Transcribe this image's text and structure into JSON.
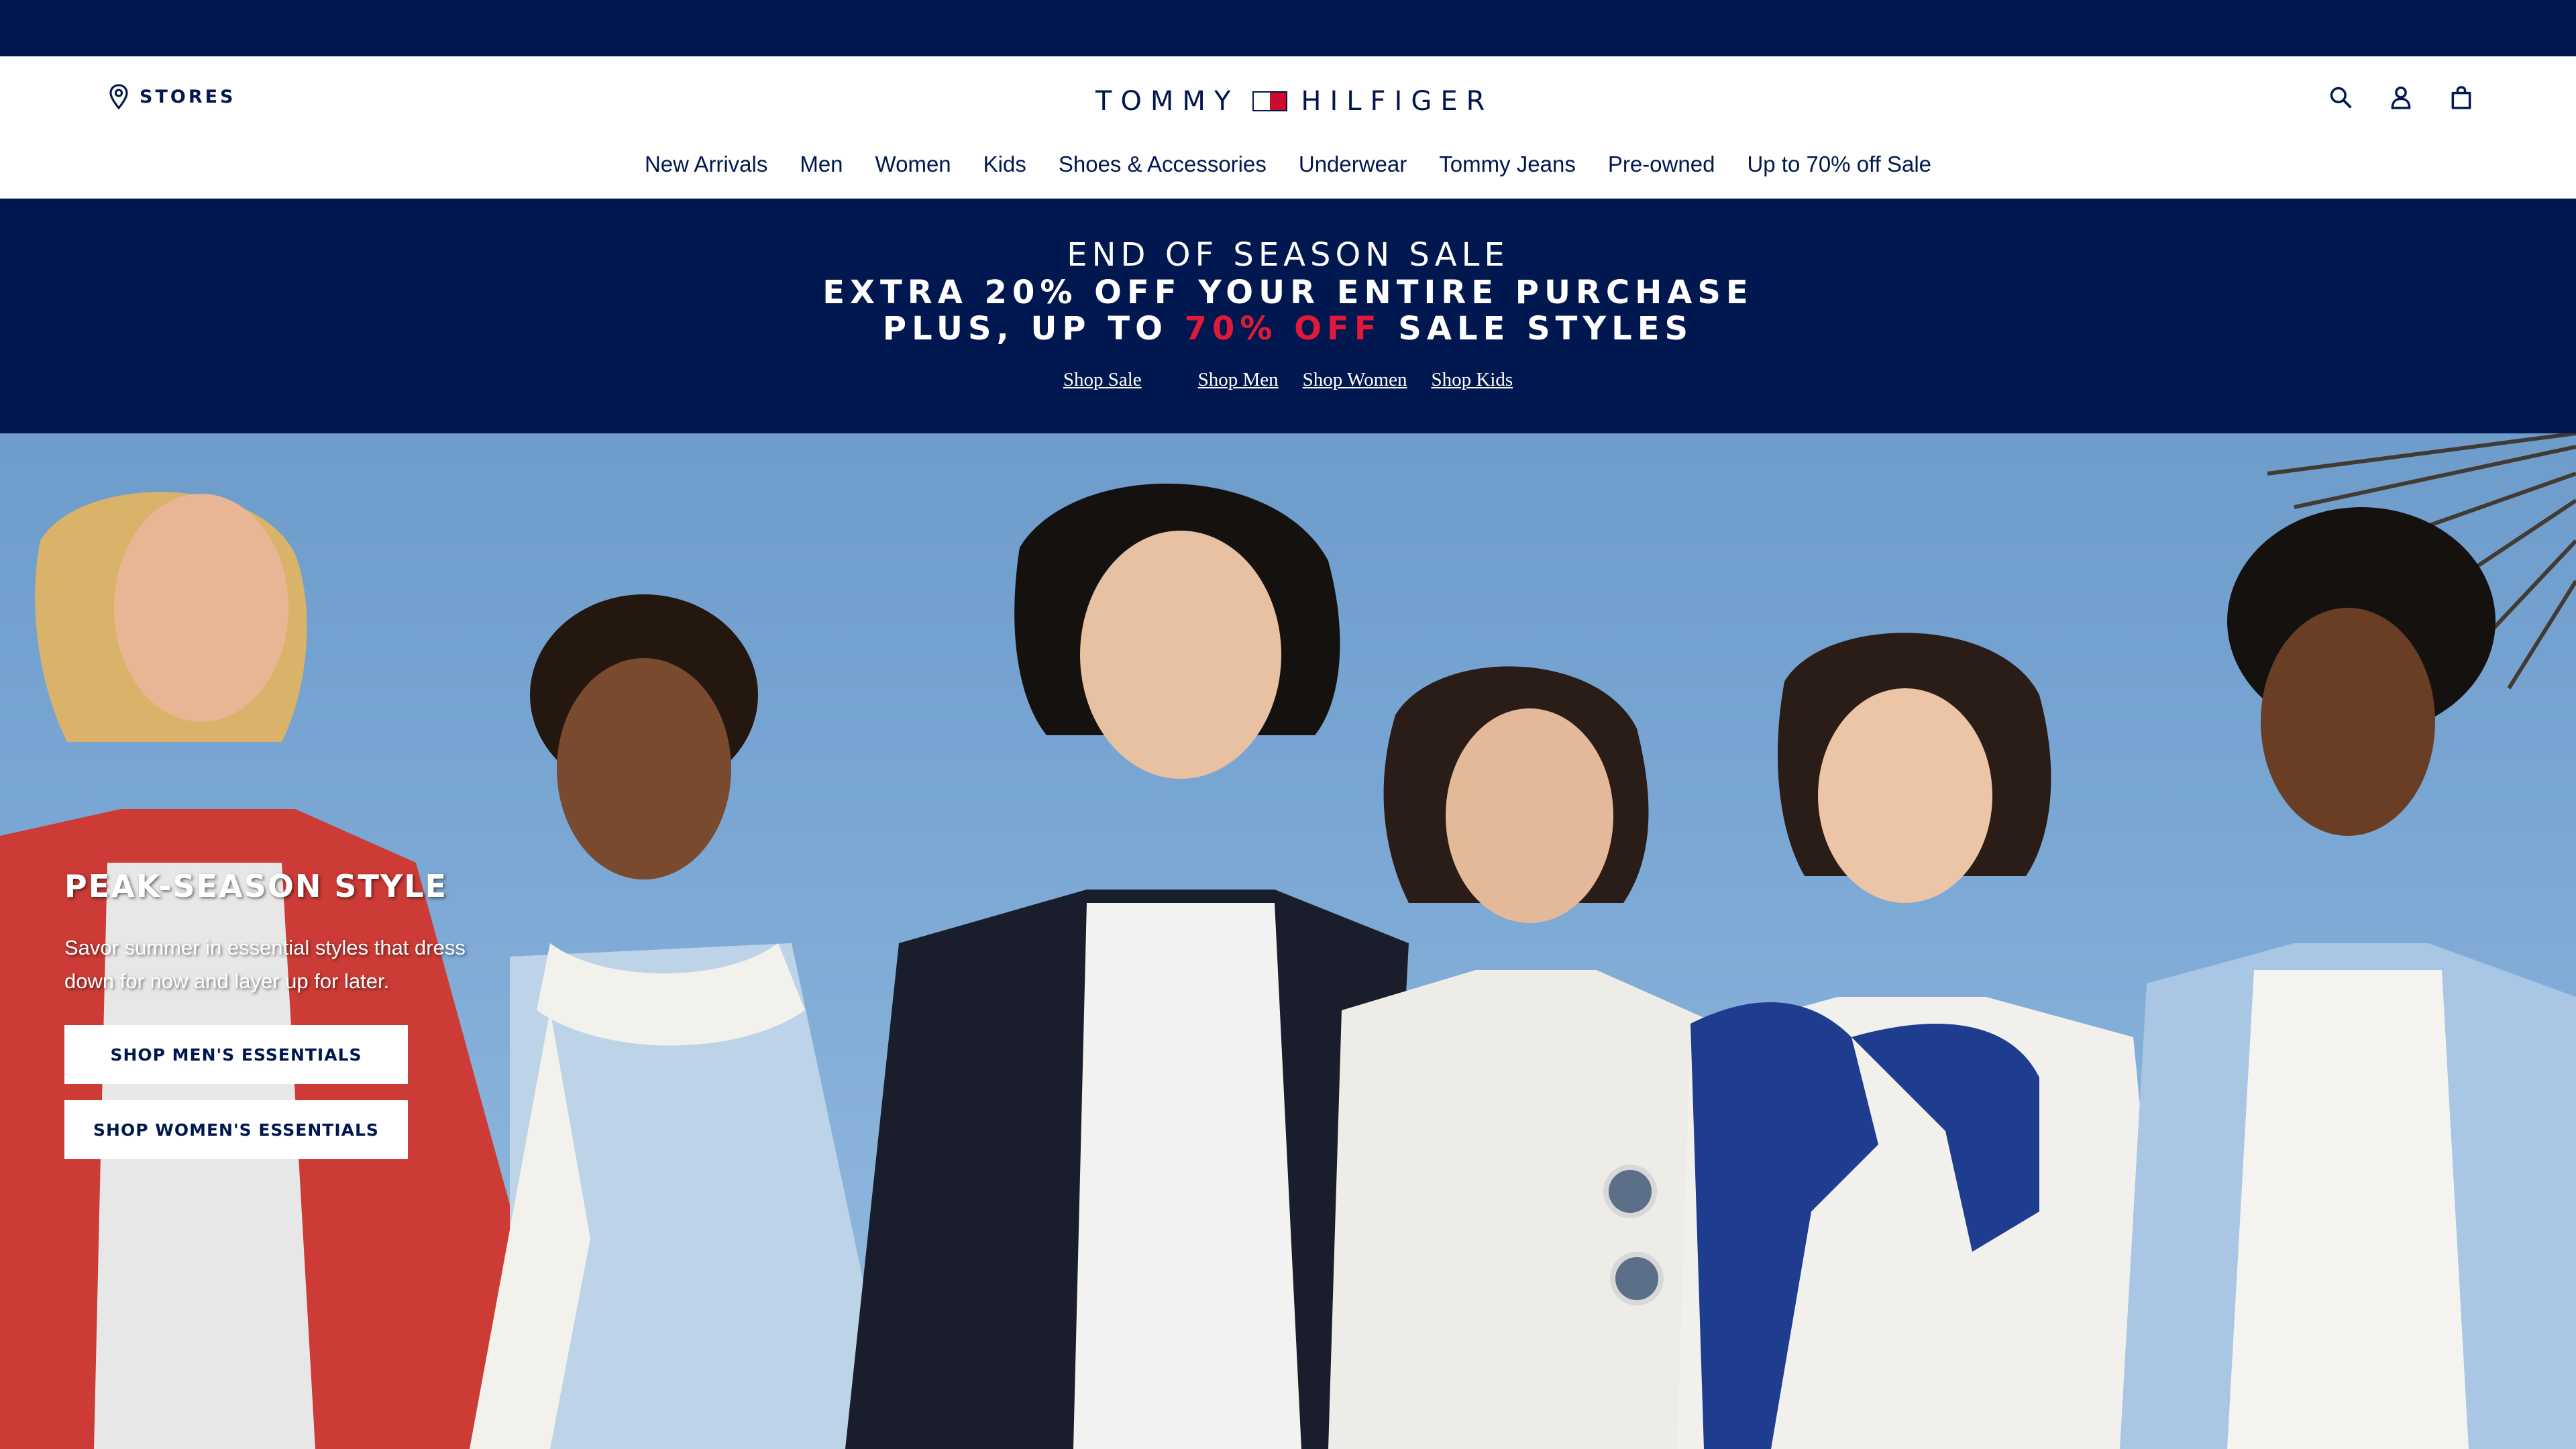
{
  "header": {
    "stores_label": "STORES",
    "logo_left": "TOMMY",
    "logo_right": "HILFIGER",
    "icons": [
      "search-icon",
      "account-icon",
      "bag-icon"
    ]
  },
  "nav": {
    "items": [
      "New Arrivals",
      "Men",
      "Women",
      "Kids",
      "Shoes & Accessories",
      "Underwear",
      "Tommy Jeans",
      "Pre-owned",
      "Up to 70% off Sale"
    ]
  },
  "promo": {
    "eyebrow": "END OF SEASON SALE",
    "line1": "EXTRA 20% OFF YOUR ENTIRE PURCHASE",
    "line2_prefix": "PLUS, UP TO ",
    "line2_accent": "70% OFF",
    "line2_suffix": " SALE STYLES",
    "links": [
      "Shop Sale",
      "Shop Men",
      "Shop Women",
      "Shop Kids"
    ]
  },
  "hero": {
    "title": "PEAK-SEASON STYLE",
    "description": "Savor summer in essential styles that dress down for now and layer up for later.",
    "button_men": "SHOP MEN'S ESSENTIALS",
    "button_women": "SHOP WOMEN'S ESSENTIALS"
  },
  "colors": {
    "navy": "#00174f",
    "red_accent": "#e0193a",
    "white": "#ffffff",
    "sky": "#7aa7d4"
  }
}
